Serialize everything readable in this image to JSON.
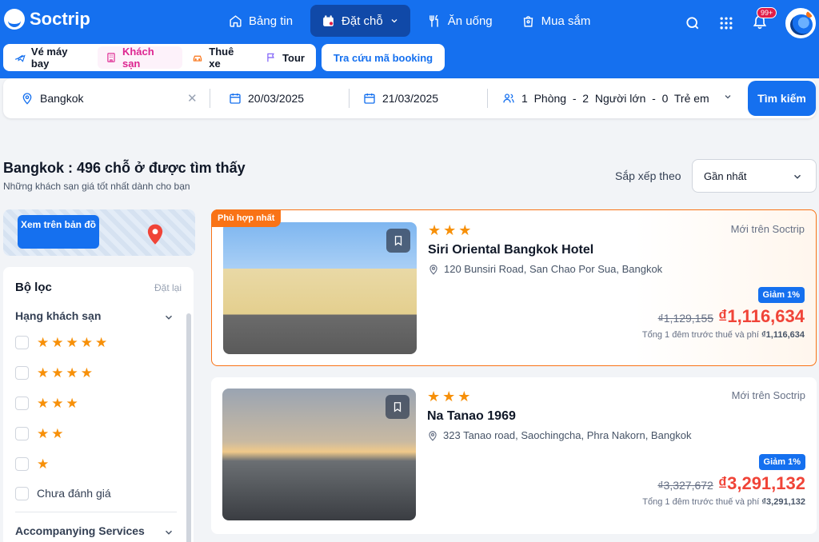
{
  "header": {
    "logo_text": "Soctrip",
    "nav": [
      {
        "label": "Bảng tin",
        "icon": "home-icon"
      },
      {
        "label": "Đặt chỗ",
        "icon": "calendar-icon"
      },
      {
        "label": "Ăn uống",
        "icon": "dining-icon"
      },
      {
        "label": "Mua sắm",
        "icon": "shopping-bag-icon"
      }
    ],
    "notification_badge": "99+"
  },
  "booking_tabs": [
    {
      "label": "Vé máy bay",
      "icon": "plane-icon"
    },
    {
      "label": "Khách sạn",
      "icon": "hotel-icon",
      "active": true
    },
    {
      "label": "Thuê xe",
      "icon": "car-icon"
    },
    {
      "label": "Tour",
      "icon": "flag-icon"
    }
  ],
  "booking_lookup_label": "Tra cứu mã booking",
  "search": {
    "location": "Bangkok",
    "checkin": "20/03/2025",
    "checkout": "21/03/2025",
    "guests": "1  Phòng  -  2  Người lớn  -  0  Trẻ em",
    "button_label": "Tìm kiếm"
  },
  "results": {
    "title": "Bangkok : 496 chỗ ở được tìm thấy",
    "subtitle": "Những khách sạn giá tốt nhất dành cho bạn",
    "sort_label": "Sắp xếp theo",
    "sort_value": "Gần nhất"
  },
  "map": {
    "button_label": "Xem trên bản đồ"
  },
  "filter": {
    "title": "Bộ lọc",
    "reset_label": "Đặt lại",
    "rating_section": "Hạng khách sạn",
    "rating_options": [
      5,
      4,
      3,
      2,
      1
    ],
    "unrated_label": "Chưa đánh giá",
    "services_section": "Accompanying Services"
  },
  "hotels": [
    {
      "badge": "Phù hợp nhất",
      "stars": 3,
      "name": "Siri Oriental Bangkok Hotel",
      "address": "120 Bunsiri Road, San Chao Por Sua, Bangkok",
      "tag": "Mới trên Soctrip",
      "discount": "Giảm 1%",
      "old_price": "₫1,129,155",
      "price": "₫1,116,634",
      "note_prefix": "Tổng 1 đêm trước thuế và phí",
      "note_price": "₫1,116,634"
    },
    {
      "badge": "",
      "stars": 3,
      "name": "Na Tanao 1969",
      "address": "323 Tanao road, Saochingcha, Phra Nakorn, Bangkok",
      "tag": "Mới trên Soctrip",
      "discount": "Giảm 1%",
      "old_price": "₫3,327,672",
      "price": "₫3,291,132",
      "note_prefix": "Tổng 1 đêm trước thuế và phí",
      "note_price": "₫3,291,132"
    }
  ]
}
